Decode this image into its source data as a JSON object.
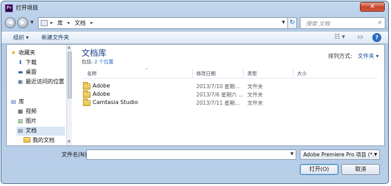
{
  "window": {
    "title": "打开项目",
    "app_icon": "Pr",
    "close": "✕"
  },
  "address": {
    "crumbs": [
      "库",
      "文档"
    ],
    "separators": [
      "▸",
      "▸",
      "▸"
    ],
    "search_placeholder": "搜索 文档"
  },
  "toolbar": {
    "organize_label": "组织 ▾",
    "new_folder_label": "新建文件夹"
  },
  "sidebar": {
    "items": [
      {
        "label": "收藏夹",
        "icon": "star-icon"
      },
      {
        "label": "下载",
        "icon": "downloads-icon"
      },
      {
        "label": "桌面",
        "icon": "desktop-icon"
      },
      {
        "label": "最近访问的位置",
        "icon": "recent-places-icon"
      },
      {
        "label": "库",
        "icon": "libraries-icon"
      },
      {
        "label": "视频",
        "icon": "video-icon"
      },
      {
        "label": "图片",
        "icon": "pictures-icon"
      },
      {
        "label": "文档",
        "icon": "documents-icon"
      },
      {
        "label": "我的文档",
        "icon": "folder-icon"
      }
    ]
  },
  "library": {
    "title": "文档库",
    "includes_label": "包括:",
    "includes_link": "2 个位置",
    "arrange_label": "排列方式:",
    "arrange_value": "文件夹 ▾"
  },
  "columns": [
    "名称",
    "修改日期",
    "类型",
    "大小"
  ],
  "files": [
    {
      "name": "Adobe",
      "date": "2013/7/10 星期...",
      "type": "文件夹"
    },
    {
      "name": "Adobe",
      "date": "2013/7/6 星期六 ...",
      "type": "文件夹"
    },
    {
      "name": "Camtasia Studio",
      "date": "2013/7/11 星期...",
      "type": "文件夹"
    }
  ],
  "footer": {
    "filename_label": "文件名(N):",
    "filename_value": "",
    "filetype_value": "Adobe Premiere Pro 项目 (*.",
    "open_label": "打开(O)",
    "cancel_label": "取消"
  },
  "colors": {
    "title_text": "#1e3f8a",
    "link": "#1f6ac6",
    "close": "#c8432b",
    "help": "#2a6bc2"
  }
}
